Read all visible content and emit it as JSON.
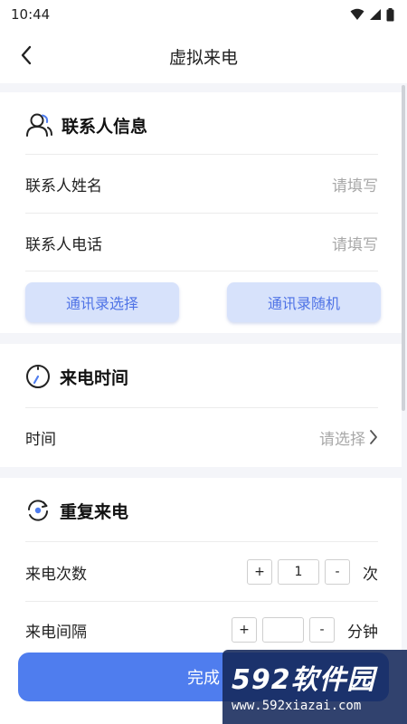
{
  "status_bar": {
    "time": "10:44"
  },
  "nav": {
    "title": "虚拟来电"
  },
  "contact_card": {
    "title": "联系人信息",
    "name_label": "联系人姓名",
    "name_placeholder": "请填写",
    "phone_label": "联系人电话",
    "phone_placeholder": "请填写",
    "btn_select": "通讯录选择",
    "btn_random": "通讯录随机"
  },
  "time_card": {
    "title": "来电时间",
    "time_label": "时间",
    "time_placeholder": "请选择"
  },
  "repeat_card": {
    "title": "重复来电",
    "count_label": "来电次数",
    "count_plus": "+",
    "count_value": "1",
    "count_minus": "-",
    "count_unit": "次",
    "interval_label": "来电间隔",
    "interval_unit": "分钟"
  },
  "footer": {
    "done_label": "完成"
  },
  "watermark": {
    "brand": "592软件园",
    "url": "www.592xiazai.com"
  },
  "colors": {
    "accent": "#4f7dee",
    "pill_bg": "#d7e2fb",
    "pill_text": "#4f73e6",
    "placeholder": "#a8a8a8"
  }
}
